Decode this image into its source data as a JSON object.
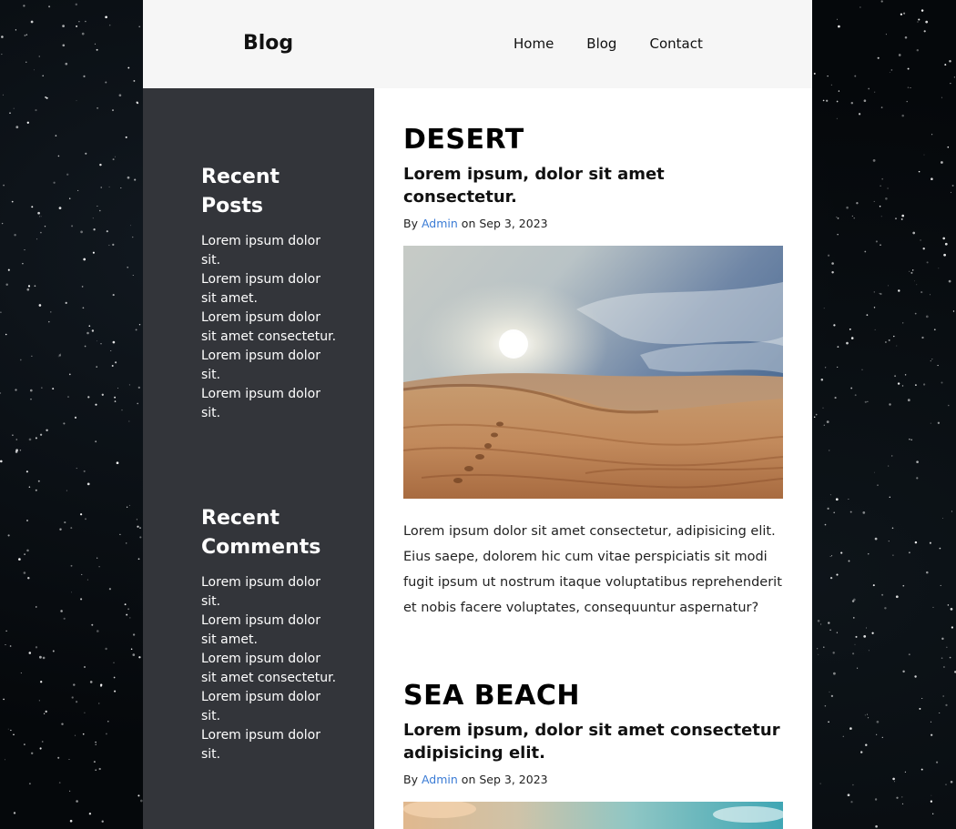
{
  "header": {
    "logo": "Blog",
    "nav": [
      {
        "label": "Home"
      },
      {
        "label": "Blog"
      },
      {
        "label": "Contact"
      }
    ]
  },
  "sidebar": {
    "recent_posts": {
      "title": "Recent Posts",
      "items": [
        "Lorem ipsum dolor sit.",
        "Lorem ipsum dolor sit amet.",
        "Lorem ipsum dolor sit amet consectetur.",
        "Lorem ipsum dolor sit.",
        "Lorem ipsum dolor sit."
      ]
    },
    "recent_comments": {
      "title": "Recent Comments",
      "items": [
        "Lorem ipsum dolor sit.",
        "Lorem ipsum dolor sit amet.",
        "Lorem ipsum dolor sit amet consectetur.",
        "Lorem ipsum dolor sit.",
        "Lorem ipsum dolor sit."
      ]
    }
  },
  "posts": [
    {
      "title": "DESERT",
      "subtitle": "Lorem ipsum, dolor sit amet consectetur.",
      "by": "By",
      "author": "Admin",
      "on": "on",
      "date": "Sep 3, 2023",
      "image_icon": "desert-photo",
      "text": "Lorem ipsum dolor sit amet consectetur, adipisicing elit. Eius saepe, dolorem hic cum vitae perspiciatis sit modi fugit ipsum ut nostrum itaque voluptatibus reprehenderit et nobis facere voluptates, consequuntur aspernatur?"
    },
    {
      "title": "SEA BEACH",
      "subtitle": "Lorem ipsum, dolor sit amet consectetur adipisicing elit.",
      "by": "By",
      "author": "Admin",
      "on": "on",
      "date": "Sep 3, 2023",
      "image_icon": "sea-beach-photo"
    }
  ],
  "colors": {
    "page_background": "#05080b",
    "header_background": "#f6f6f6",
    "sidebar_background": "#33353a",
    "link": "#3a7bd5"
  }
}
